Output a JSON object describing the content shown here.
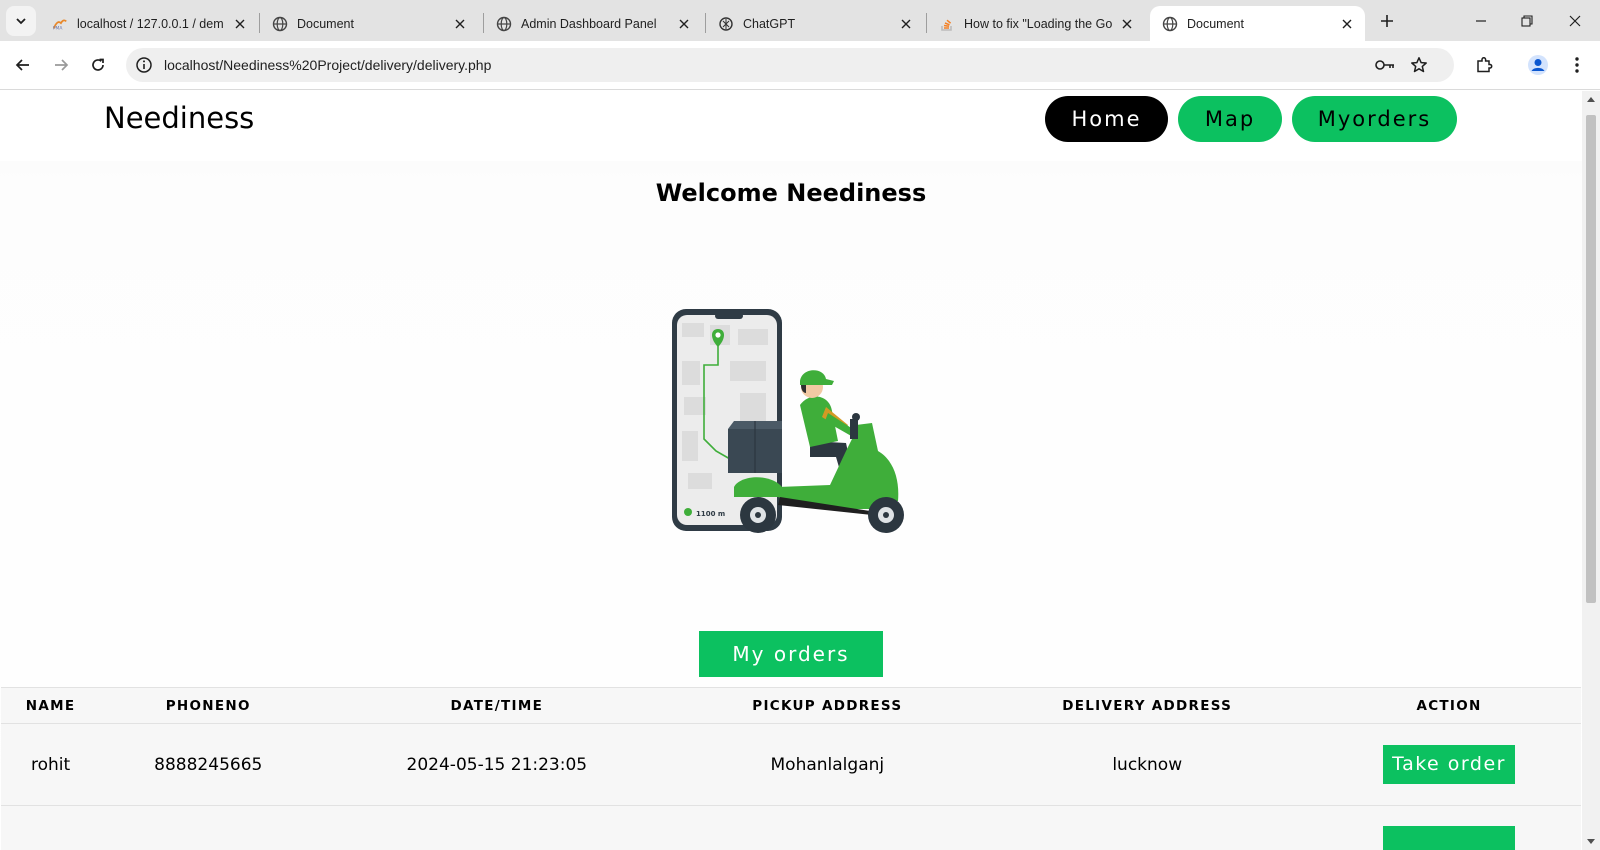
{
  "browser": {
    "tabs": [
      {
        "title": "localhost / 127.0.0.1 / dem",
        "favicon": "phpmyadmin-icon"
      },
      {
        "title": "Document",
        "favicon": "globe-icon"
      },
      {
        "title": "Admin Dashboard Panel",
        "favicon": "globe-icon"
      },
      {
        "title": "ChatGPT",
        "favicon": "chatgpt-icon"
      },
      {
        "title": "How to fix \"Loading the Go",
        "favicon": "stack-overflow-icon"
      },
      {
        "title": "Document",
        "favicon": "globe-icon",
        "active": true
      }
    ],
    "url": "localhost/Neediness%20Project/delivery/delivery.php"
  },
  "navbar": {
    "brand": "Neediness",
    "links": {
      "home": "Home",
      "map": "Map",
      "myorders": "Myorders"
    }
  },
  "hero": {
    "title": "Welcome Neediness",
    "distance_label": "1100 m"
  },
  "orders_section": {
    "button_label": "My orders",
    "columns": [
      "NAME",
      "PHONENO",
      "DATE/TIME",
      "PICKUP ADDRESS",
      "DELIVERY ADDRESS",
      "ACTION"
    ],
    "rows": [
      {
        "name": "rohit",
        "phone": "8888245665",
        "datetime": "2024-05-15 21:23:05",
        "pickup": "Mohanlalganj",
        "delivery": "lucknow",
        "action": "Take order"
      }
    ]
  },
  "colors": {
    "accent": "#0cc160",
    "nav_active": "#000000"
  }
}
